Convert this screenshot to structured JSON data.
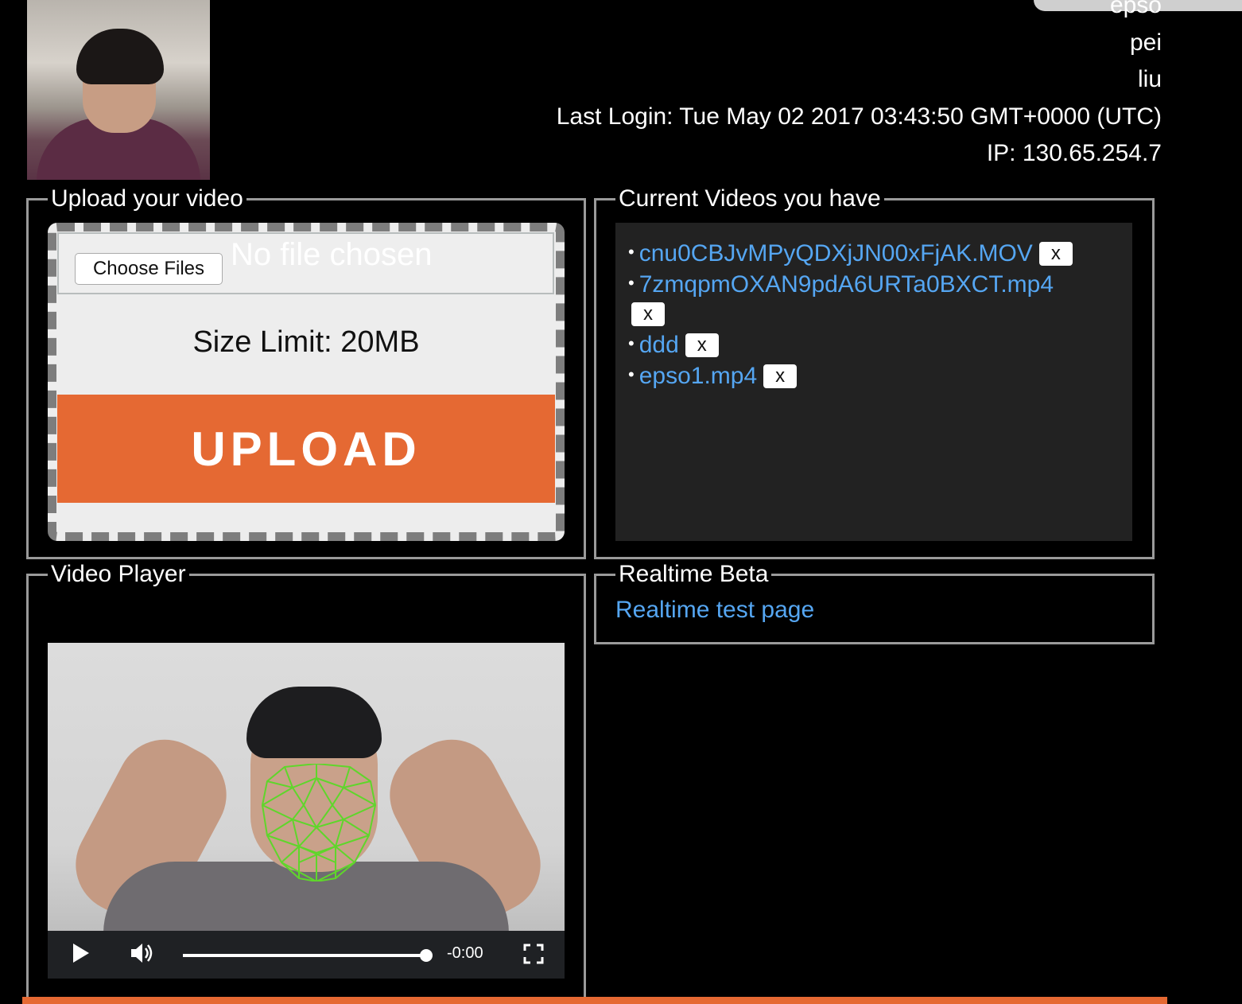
{
  "user": {
    "name_lines": [
      "epso",
      "pei",
      "liu"
    ],
    "last_login": "Last Login: Tue May 02 2017 03:43:50 GMT+0000 (UTC)",
    "ip": "IP: 130.65.254.7"
  },
  "upload": {
    "legend": "Upload your video",
    "choose_files_label": "Choose Files",
    "no_file_text": "No file chosen",
    "size_limit": "Size Limit: 20MB",
    "upload_label": "UPLOAD"
  },
  "videos": {
    "legend": "Current Videos you have",
    "items": [
      {
        "name": "cnu0CBJvMPyQDXjJN00xFjAK.MOV",
        "delete_label": "x"
      },
      {
        "name": "7zmqpmOXAN9pdA6URTa0BXCT.mp4",
        "delete_label": "x"
      },
      {
        "name": "ddd",
        "delete_label": "x"
      },
      {
        "name": "epso1.mp4",
        "delete_label": "x"
      }
    ]
  },
  "player": {
    "legend": "Video Player",
    "time": "-0:00",
    "progress": 1.0
  },
  "realtime": {
    "legend": "Realtime Beta",
    "link_text": "Realtime test page"
  },
  "colors": {
    "accent": "#e56933",
    "link": "#55a6f2",
    "mesh": "#5fd62b"
  }
}
